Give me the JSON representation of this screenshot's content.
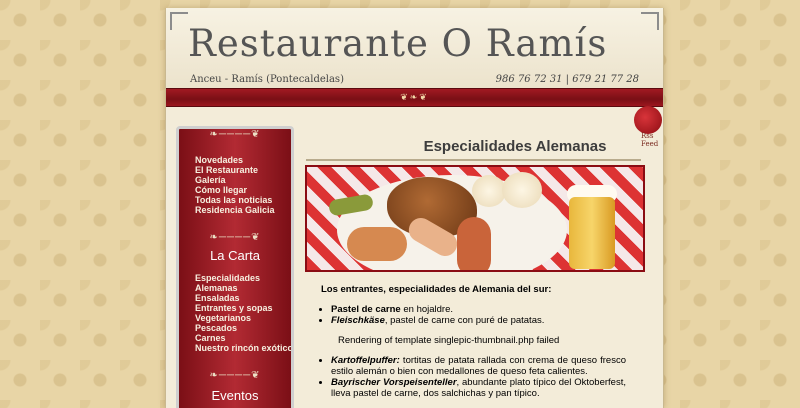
{
  "header": {
    "title": "Restaurante O Ramís",
    "subtitle": "Anceu - Ramís (Pontecaldelas)",
    "phones": "986 76 72 31 | 679 21 77 28"
  },
  "rss": {
    "label": "Rss Feed"
  },
  "sidebar": {
    "menu": [
      {
        "label": "Novedades"
      },
      {
        "label": "El Restaurante"
      },
      {
        "label": "Galería"
      },
      {
        "label": "Cómo llegar"
      },
      {
        "label": "Todas las noticias"
      },
      {
        "label": "Residencia Galicia"
      }
    ],
    "carta": {
      "heading": "La Carta",
      "items": [
        {
          "label": "Especialidades"
        },
        {
          "label": "Alemanas"
        },
        {
          "label": "Ensaladas"
        },
        {
          "label": "Entrantes y sopas"
        },
        {
          "label": "Vegetarianos"
        },
        {
          "label": "Pescados"
        },
        {
          "label": "Carnes"
        },
        {
          "label": "Nuestro rincón exótico"
        }
      ]
    },
    "eventos": {
      "heading": "Eventos"
    }
  },
  "main": {
    "title": "Especialidades Alemanas",
    "intro": "Los entrantes, especialidades de Alemania del sur:",
    "list1": [
      {
        "name": "Pastel de carne",
        "desc": " en hojaldre."
      },
      {
        "name": "Fleischkäse",
        "desc": ", pastel de carne con puré de patatas."
      }
    ],
    "gallery_message": "Rendering of template singlepic-thumbnail.php failed",
    "list2": [
      {
        "name": "Kartoffelpuffer:",
        "desc": " tortitas de patata rallada con crema de queso fresco estilo alemán o bien con medallones de queso feta calientes."
      },
      {
        "name": "Bayrischer Vorspeisenteller",
        "desc": ", abundante plato típico del Oktoberfest, lleva pastel de carne, dos salchichas y pan típico."
      }
    ]
  }
}
